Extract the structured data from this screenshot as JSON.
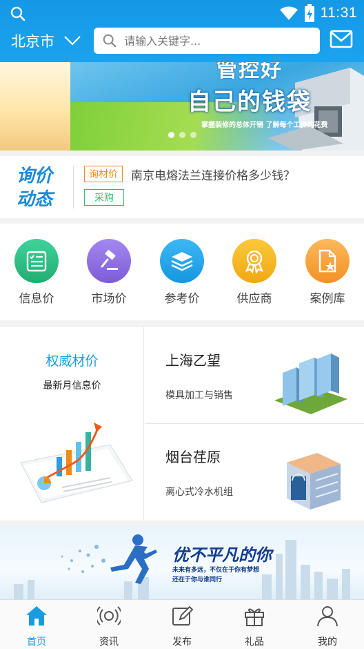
{
  "status_bar": {
    "time": "11:31"
  },
  "header": {
    "city": "北京市",
    "search_placeholder": "请输入关键字..."
  },
  "banner": {
    "headline_top": "管控好",
    "headline": "自己的钱袋",
    "sub": "掌握装修的总体开销  了解每个工种的花费",
    "dots": 3,
    "active_dot": 0
  },
  "inquiry": {
    "logo_line1": "询价",
    "logo_line2": "动态",
    "tag1": "询材价",
    "tag2": "采购",
    "text": "南京电熔法兰连接价格多少钱？"
  },
  "categories": [
    {
      "label": "信息价",
      "color": "#2dbf86",
      "icon": "list-icon"
    },
    {
      "label": "市场价",
      "color": "#8f6fe0",
      "icon": "gavel-icon"
    },
    {
      "label": "参考价",
      "color": "#1ea6ee",
      "icon": "layers-icon"
    },
    {
      "label": "供应商",
      "color": "#f5b51e",
      "icon": "award-icon"
    },
    {
      "label": "案例库",
      "color": "#f7a13a",
      "icon": "document-star-icon"
    }
  ],
  "blocks": {
    "left_title": "权威材价",
    "left_sub": "最新月信息价",
    "right": [
      {
        "title": "上海乙望",
        "sub": "模具加工与销售"
      },
      {
        "title": "烟台荏原",
        "sub": "离心式冷水机组"
      }
    ]
  },
  "bottom_banner": {
    "title": "优不平凡的你",
    "line1": "未来有多远，不仅在于你有梦想",
    "line2": "还在于你与谁同行"
  },
  "tabbar": {
    "active": 0,
    "tabs": [
      {
        "label": "首页",
        "icon": "home-icon"
      },
      {
        "label": "资讯",
        "icon": "broadcast-icon"
      },
      {
        "label": "发布",
        "icon": "edit-icon"
      },
      {
        "label": "礼品",
        "icon": "gift-icon"
      },
      {
        "label": "我的",
        "icon": "user-icon"
      }
    ]
  },
  "colors": {
    "primary": "#1aa3ee",
    "accent_orange": "#f08a1c",
    "accent_green": "#37bb6e"
  }
}
